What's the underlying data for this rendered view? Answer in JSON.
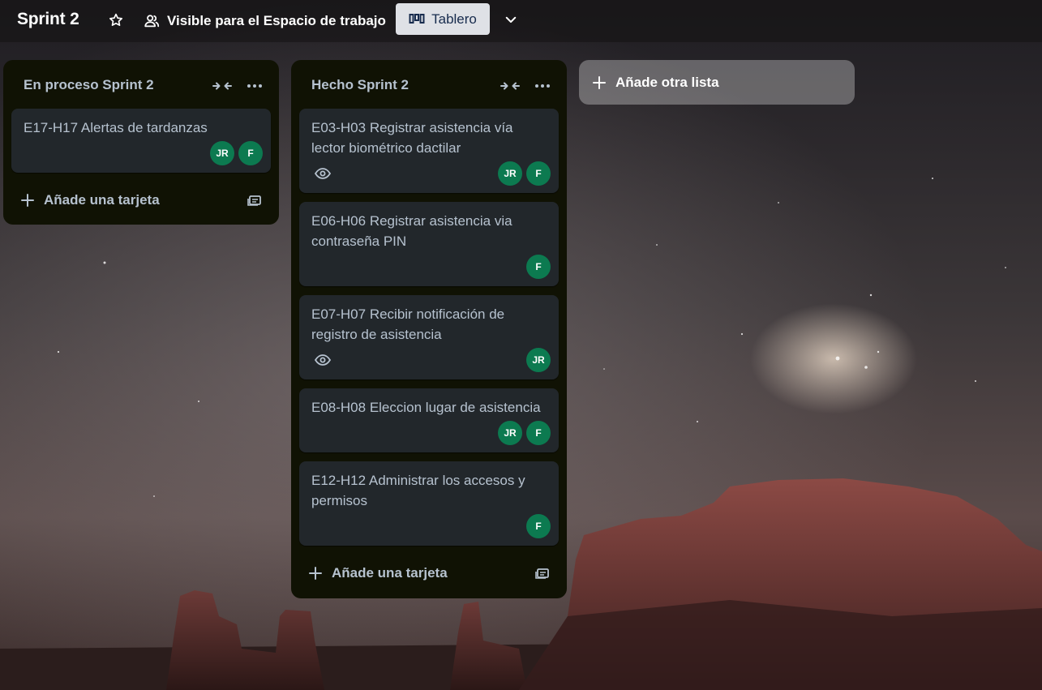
{
  "board": {
    "title": "Sprint 2",
    "visibility_label": "Visible para el Espacio de trabajo",
    "view_label": "Tablero"
  },
  "lists": [
    {
      "title": "En proceso Sprint 2",
      "cards": [
        {
          "title": "E17-H17 Alertas de tardanzas",
          "watching": false,
          "members": [
            "JR",
            "F"
          ]
        }
      ],
      "add_card_label": "Añade una tarjeta"
    },
    {
      "title": "Hecho Sprint 2",
      "cards": [
        {
          "title": "E03-H03 Registrar asistencia vía lector biométrico dactilar",
          "watching": true,
          "members": [
            "JR",
            "F"
          ]
        },
        {
          "title": "E06-H06 Registrar asistencia via contraseña PIN",
          "watching": false,
          "members": [
            "F"
          ]
        },
        {
          "title": "E07-H07 Recibir notificación de registro de asistencia",
          "watching": true,
          "members": [
            "JR"
          ]
        },
        {
          "title": "E08-H08 Eleccion lugar de asistencia",
          "watching": false,
          "members": [
            "JR",
            "F"
          ]
        },
        {
          "title": "E12-H12 Administrar los accesos y permisos",
          "watching": false,
          "members": [
            "F"
          ]
        }
      ],
      "add_card_label": "Añade una tarjeta"
    }
  ],
  "add_list_label": "Añade otra lista",
  "colors": {
    "list_bg": "#101204",
    "card_bg": "#22272b",
    "card_text": "#b6c2cf",
    "avatar_bg": "#0c7a50",
    "view_button_bg": "#dfe1e6"
  },
  "icons": {
    "star": "star-icon",
    "visibility": "people-icon",
    "view": "board-icon",
    "view_menu": "chevron-down-icon",
    "collapse": "collapse-icon",
    "more": "more-icon",
    "watch": "eye-icon",
    "add": "plus-icon",
    "template": "template-icon"
  }
}
